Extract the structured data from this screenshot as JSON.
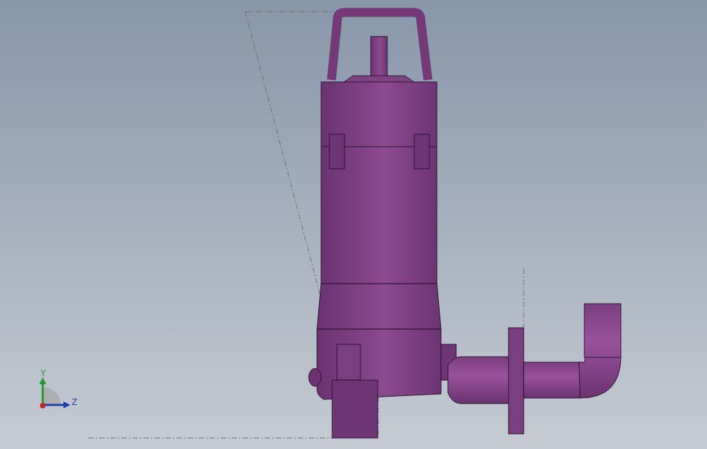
{
  "viewport": {
    "triad": {
      "axes": [
        {
          "kind": "vertical",
          "label": "Y"
        },
        {
          "kind": "horizontal",
          "label": "Z"
        }
      ]
    }
  }
}
